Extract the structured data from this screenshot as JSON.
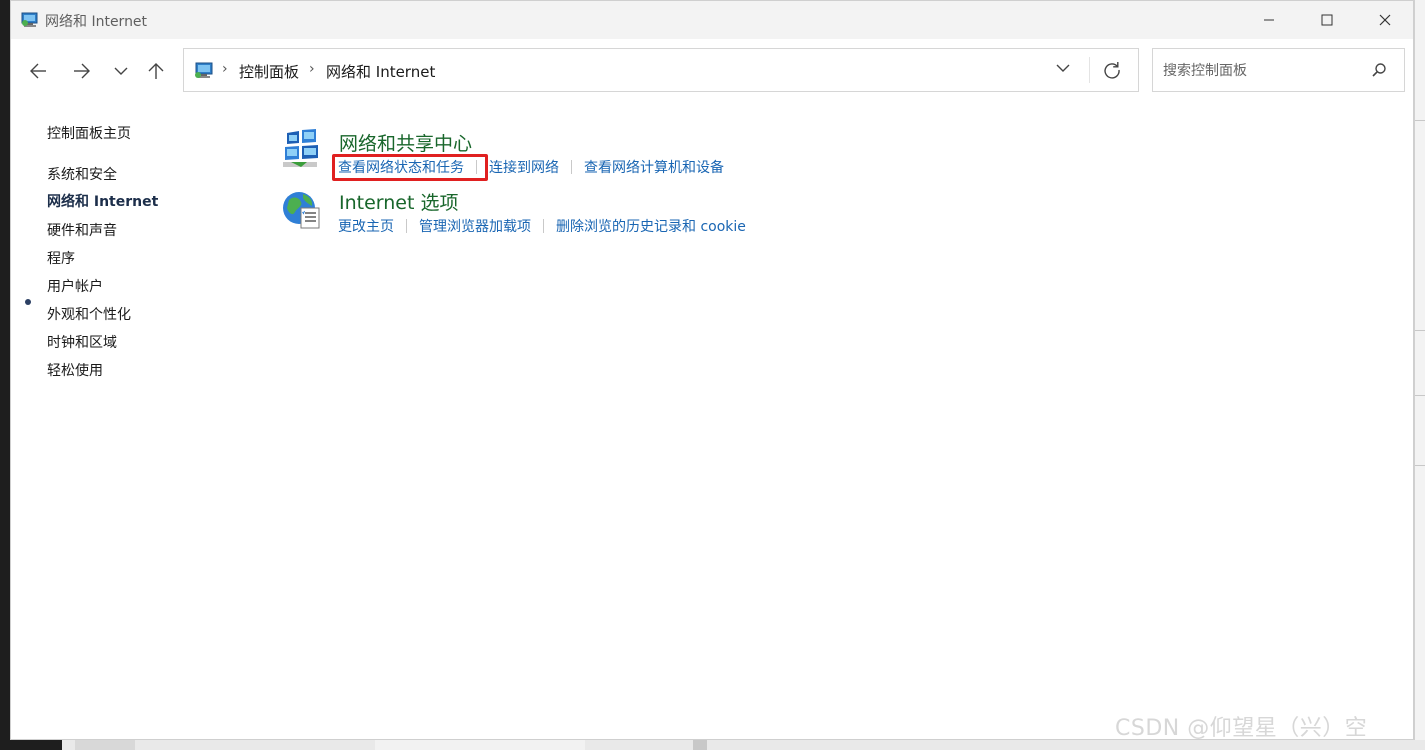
{
  "window": {
    "title": "网络和 Internet"
  },
  "address_bar": {
    "crumbs": [
      "控制面板",
      "网络和 Internet"
    ]
  },
  "search": {
    "placeholder": "搜索控制面板"
  },
  "sidebar": {
    "items": [
      {
        "label": "控制面板主页"
      },
      {
        "label": "系统和安全"
      },
      {
        "label": "网络和 Internet"
      },
      {
        "label": "硬件和声音"
      },
      {
        "label": "程序"
      },
      {
        "label": "用户帐户"
      },
      {
        "label": "外观和个性化"
      },
      {
        "label": "时钟和区域"
      },
      {
        "label": "轻松使用"
      }
    ]
  },
  "sections": [
    {
      "title": "网络和共享中心",
      "icon": "network-sharing-center-icon",
      "links": [
        "查看网络状态和任务",
        "连接到网络",
        "查看网络计算机和设备"
      ]
    },
    {
      "title": "Internet 选项",
      "icon": "internet-options-icon",
      "links": [
        "更改主页",
        "管理浏览器加载项",
        "删除浏览的历史记录和 cookie"
      ]
    }
  ],
  "watermark": "CSDN @仰望星（兴）空",
  "colors": {
    "link": "#1a66b3",
    "section_title": "#18662b",
    "highlight": "#e02020"
  }
}
